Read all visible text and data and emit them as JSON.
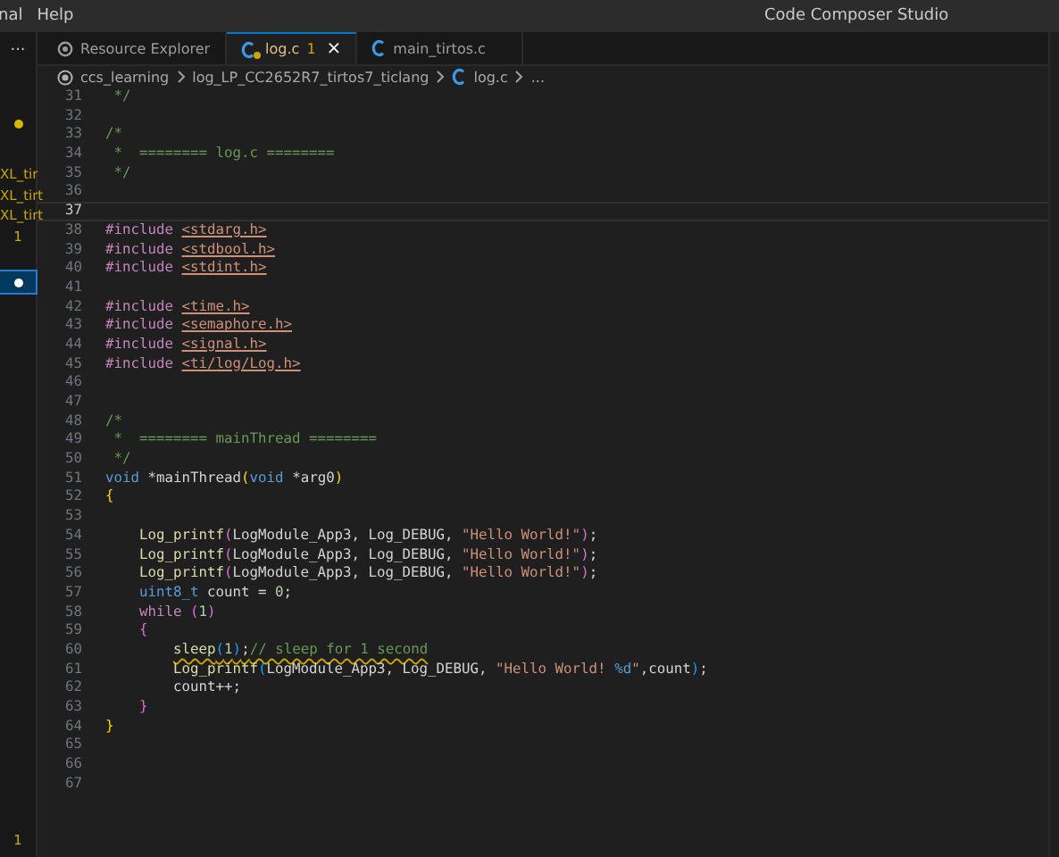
{
  "menu": [
    "nal",
    "Help"
  ],
  "window": {
    "title": "Code Composer Studio"
  },
  "side_panel": {
    "more": "...",
    "items": [
      {
        "kind": "dot",
        "selected": false
      },
      {
        "kind": "text",
        "text": "XL_tir",
        "selected": false
      },
      {
        "kind": "text",
        "text": "XL_tirt",
        "selected": false
      },
      {
        "kind": "text",
        "text": "XL_tirt",
        "selected": false
      },
      {
        "kind": "count",
        "text": "1",
        "selected": false
      },
      {
        "kind": "dot",
        "selected": true
      }
    ],
    "footer_count": "1"
  },
  "tabs": [
    {
      "label": "Resource Explorer",
      "kind": "web",
      "selected": false
    },
    {
      "label": "log.c",
      "kind": "c",
      "selected": true,
      "warning": true,
      "badge": "1",
      "close": "×"
    },
    {
      "label": "main_tirtos.c",
      "kind": "c",
      "selected": false
    }
  ],
  "breadcrumb": [
    {
      "label": "ccs_learning",
      "kind": "project"
    },
    {
      "label": "log_LP_CC2652R7_tirtos7_ticlang",
      "kind": "folder"
    },
    {
      "label": "log.c",
      "kind": "c"
    },
    {
      "label": "...",
      "kind": "more"
    }
  ],
  "lines": [
    {
      "number": "31",
      "tokens": [
        {
          "kind": "comment",
          "text": " */"
        }
      ]
    },
    {
      "number": "32"
    },
    {
      "number": "33",
      "tokens": [
        {
          "kind": "comment",
          "text": "/*"
        }
      ]
    },
    {
      "number": "34",
      "tokens": [
        {
          "kind": "comment",
          "text": " *  ======== log.c ========"
        }
      ]
    },
    {
      "number": "35",
      "tokens": [
        {
          "kind": "comment",
          "text": " */"
        }
      ]
    },
    {
      "number": "36"
    },
    {
      "number": "37",
      "current": true
    },
    {
      "number": "38",
      "tokens": [
        {
          "kind": "macro",
          "text": "#include "
        },
        {
          "kind": "path",
          "text": "<stdarg.h>"
        }
      ]
    },
    {
      "number": "39",
      "tokens": [
        {
          "kind": "macro",
          "text": "#include "
        },
        {
          "kind": "path",
          "text": "<stdbool.h>"
        }
      ]
    },
    {
      "number": "40",
      "tokens": [
        {
          "kind": "macro",
          "text": "#include "
        },
        {
          "kind": "path",
          "text": "<stdint.h>"
        }
      ]
    },
    {
      "number": "41"
    },
    {
      "number": "42",
      "tokens": [
        {
          "kind": "macro",
          "text": "#include "
        },
        {
          "kind": "path",
          "text": "<time.h>"
        }
      ]
    },
    {
      "number": "43",
      "tokens": [
        {
          "kind": "macro",
          "text": "#include "
        },
        {
          "kind": "path",
          "text": "<semaphore.h>"
        }
      ]
    },
    {
      "number": "44",
      "tokens": [
        {
          "kind": "macro",
          "text": "#include "
        },
        {
          "kind": "path",
          "text": "<signal.h>"
        }
      ]
    },
    {
      "number": "45",
      "tokens": [
        {
          "kind": "macro",
          "text": "#include "
        },
        {
          "kind": "path",
          "text": "<ti/log/Log.h>"
        }
      ]
    },
    {
      "number": "46"
    },
    {
      "number": "47"
    },
    {
      "number": "48",
      "tokens": [
        {
          "kind": "comment",
          "text": "/*"
        }
      ]
    },
    {
      "number": "49",
      "tokens": [
        {
          "kind": "comment",
          "text": " *  ======== mainThread ========"
        }
      ]
    },
    {
      "number": "50",
      "tokens": [
        {
          "kind": "comment",
          "text": " */"
        }
      ]
    },
    {
      "number": "51",
      "tokens": [
        {
          "kind": "keyword",
          "text": "void"
        },
        {
          "kind": "plain",
          "text": " *mainThread"
        },
        {
          "kind": "bracket1",
          "text": "("
        },
        {
          "kind": "keyword",
          "text": "void"
        },
        {
          "kind": "plain",
          "text": " *arg0"
        },
        {
          "kind": "bracket1",
          "text": ")"
        }
      ]
    },
    {
      "number": "52",
      "tokens": [
        {
          "kind": "bracket1",
          "text": "{"
        }
      ]
    },
    {
      "number": "53"
    },
    {
      "number": "54",
      "tokens": [
        {
          "kind": "func",
          "text": "    Log_printf"
        },
        {
          "kind": "bracket2",
          "text": "("
        },
        {
          "kind": "plain",
          "text": "LogModule_App3, Log_DEBUG, "
        },
        {
          "kind": "string",
          "text": "\"Hello World!\""
        },
        {
          "kind": "bracket2",
          "text": ")"
        },
        {
          "kind": "plain",
          "text": ";"
        }
      ]
    },
    {
      "number": "55",
      "tokens": [
        {
          "kind": "func",
          "text": "    Log_printf"
        },
        {
          "kind": "bracket2",
          "text": "("
        },
        {
          "kind": "plain",
          "text": "LogModule_App3, Log_DEBUG, "
        },
        {
          "kind": "string",
          "text": "\"Hello World!\""
        },
        {
          "kind": "bracket2",
          "text": ")"
        },
        {
          "kind": "plain",
          "text": ";"
        }
      ]
    },
    {
      "number": "56",
      "tokens": [
        {
          "kind": "func",
          "text": "    Log_printf"
        },
        {
          "kind": "bracket2",
          "text": "("
        },
        {
          "kind": "plain",
          "text": "LogModule_App3, Log_DEBUG, "
        },
        {
          "kind": "string",
          "text": "\"Hello World!\""
        },
        {
          "kind": "bracket2",
          "text": ")"
        },
        {
          "kind": "plain",
          "text": ";"
        }
      ]
    },
    {
      "number": "57",
      "tokens": [
        {
          "kind": "keyword",
          "text": "    uint8_t"
        },
        {
          "kind": "plain",
          "text": " count = "
        },
        {
          "kind": "number",
          "text": "0"
        },
        {
          "kind": "plain",
          "text": ";"
        }
      ]
    },
    {
      "number": "58",
      "tokens": [
        {
          "kind": "control",
          "text": "    while "
        },
        {
          "kind": "bracket2",
          "text": "("
        },
        {
          "kind": "number",
          "text": "1"
        },
        {
          "kind": "bracket2",
          "text": ")"
        }
      ]
    },
    {
      "number": "59",
      "tokens": [
        {
          "kind": "bracket2",
          "text": "    {"
        }
      ]
    },
    {
      "number": "60",
      "warning": true,
      "tokens": [
        {
          "kind": "func",
          "text": "        sleep"
        },
        {
          "kind": "bracket3",
          "text": "("
        },
        {
          "kind": "number",
          "text": "1"
        },
        {
          "kind": "bracket3",
          "text": ")"
        },
        {
          "kind": "plain",
          "text": ";"
        },
        {
          "kind": "comment",
          "text": "// sleep for 1 second"
        }
      ]
    },
    {
      "number": "61",
      "tokens": [
        {
          "kind": "func",
          "text": "        Log_printf"
        },
        {
          "kind": "bracket3",
          "text": "("
        },
        {
          "kind": "plain",
          "text": "LogModule_App3, Log_DEBUG, "
        },
        {
          "kind": "string",
          "text": "\"Hello World! "
        },
        {
          "kind": "escape",
          "text": "%d"
        },
        {
          "kind": "string",
          "text": "\""
        },
        {
          "kind": "plain",
          "text": ",count"
        },
        {
          "kind": "bracket3",
          "text": ")"
        },
        {
          "kind": "plain",
          "text": ";"
        }
      ]
    },
    {
      "number": "62",
      "tokens": [
        {
          "kind": "plain",
          "text": "        count++;"
        }
      ]
    },
    {
      "number": "63",
      "tokens": [
        {
          "kind": "bracket2",
          "text": "    }"
        }
      ]
    },
    {
      "number": "64",
      "tokens": [
        {
          "kind": "bracket1",
          "text": "}"
        }
      ]
    },
    {
      "number": "65"
    },
    {
      "number": "66"
    },
    {
      "number": "67"
    }
  ]
}
